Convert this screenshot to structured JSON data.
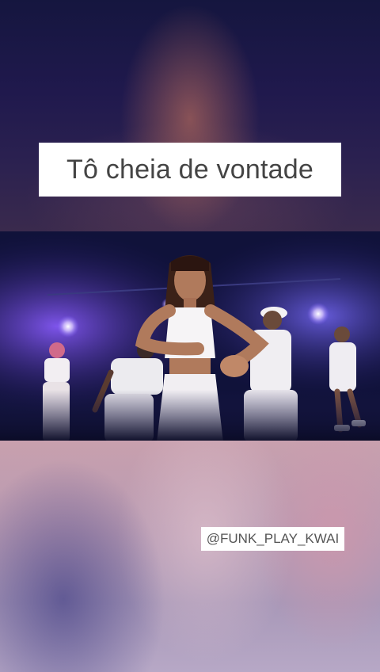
{
  "caption": {
    "text": "Tô cheia de vontade"
  },
  "watermark": {
    "handle": "@FUNK_PLAY_KWAI"
  },
  "colors": {
    "caption_text": "#444444",
    "stage_dark": "#0d1035",
    "stage_light": "#7b4cff",
    "outfit": "#f2eef2"
  }
}
